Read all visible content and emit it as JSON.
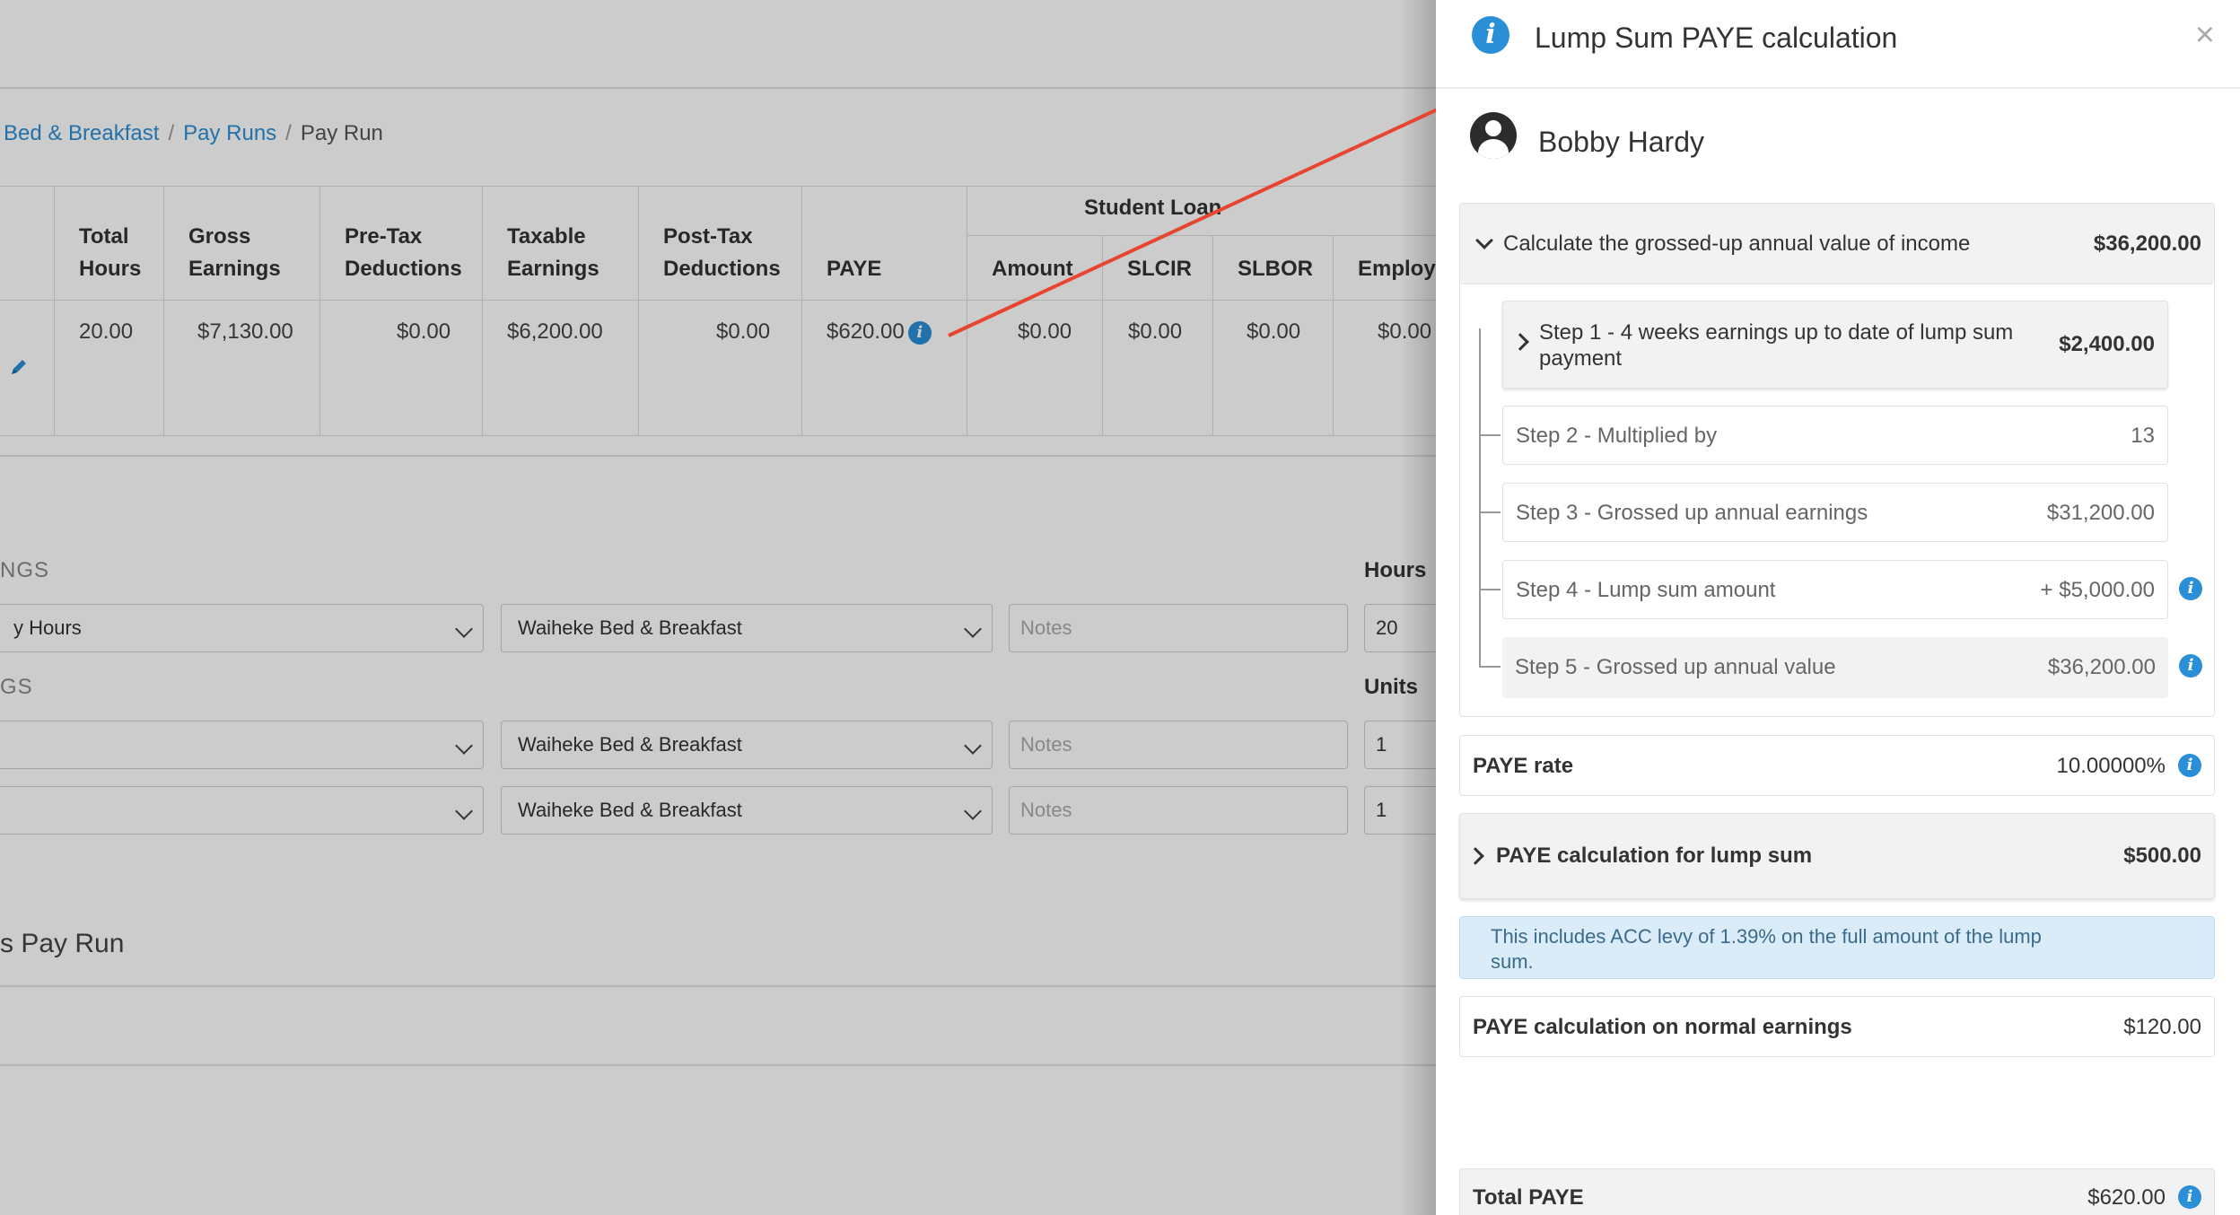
{
  "breadcrumb": {
    "items": [
      "Bed & Breakfast",
      "Pay Runs"
    ],
    "current": "Pay Run",
    "separator": "/"
  },
  "payrun_table": {
    "group_header": "Student Loan",
    "columns": [
      "Total Hours",
      "Gross Earnings",
      "Pre-Tax Deductions",
      "Taxable Earnings",
      "Post-Tax Deductions",
      "PAYE",
      "Amount",
      "SLCIR",
      "SLBOR",
      "Employ"
    ],
    "row": [
      "20.00",
      "$7,130.00",
      "$0.00",
      "$6,200.00",
      "$0.00",
      "$620.00",
      "$0.00",
      "$0.00",
      "$0.00",
      "$0.00"
    ],
    "edit_icon": "pencil-icon"
  },
  "earnings": {
    "section1_label": "NGS",
    "section1_col": "Hours",
    "row1": {
      "type": "y Hours",
      "location": "Waiheke Bed & Breakfast",
      "notes_placeholder": "Notes",
      "qty": "20"
    },
    "section2_label": "GS",
    "section2_col": "Units",
    "row2": {
      "type": "",
      "location": "Waiheke Bed & Breakfast",
      "notes_placeholder": "Notes",
      "qty": "1"
    },
    "row3": {
      "type": "",
      "location": "Waiheke Bed & Breakfast",
      "notes_placeholder": "Notes",
      "qty": "1"
    }
  },
  "payrun_section_title": "s Pay Run",
  "modal": {
    "title": "Lump Sum PAYE calculation",
    "close": "×",
    "employee": "Bobby Hardy",
    "gross_up": {
      "label": "Calculate the grossed-up annual value of income",
      "value": "$36,200.00",
      "steps": [
        {
          "label": "Step 1 - 4 weeks earnings up to date of lump sum payment",
          "value": "$2,400.00"
        },
        {
          "label": "Step 2 - Multiplied by",
          "value": "13"
        },
        {
          "label": "Step 3 - Grossed up annual earnings",
          "value": "$31,200.00"
        },
        {
          "label": "Step 4 - Lump sum amount",
          "value": "+ $5,000.00"
        },
        {
          "label": "Step 5 - Grossed up annual value",
          "value": "$36,200.00"
        }
      ]
    },
    "paye_rate": {
      "label": "PAYE rate",
      "value": "10.00000%"
    },
    "paye_lump": {
      "label": "PAYE calculation for lump sum",
      "value": "$500.00"
    },
    "notice": "This includes ACC levy of 1.39% on the full amount of the lump sum.",
    "paye_normal": {
      "label": "PAYE calculation on normal earnings",
      "value": "$120.00"
    },
    "total": {
      "label": "Total PAYE",
      "value": "$620.00"
    }
  },
  "colors": {
    "link": "#2a8fd6",
    "arrow": "#e8452f",
    "notice_bg": "#d9ecf8"
  }
}
